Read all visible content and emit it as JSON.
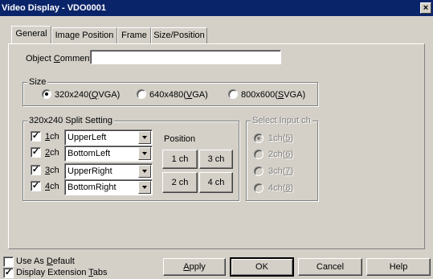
{
  "window": {
    "title": "Video Display - VDO0001",
    "close_glyph": "×"
  },
  "tabs": [
    {
      "label": "General",
      "active": true
    },
    {
      "label": "Image Position",
      "active": false
    },
    {
      "label": "Frame",
      "active": false
    },
    {
      "label": "Size/Position",
      "active": false
    }
  ],
  "object_comment": {
    "label_pre": "Object ",
    "label_key": "C",
    "label_post": "omment",
    "value": ""
  },
  "size": {
    "legend": "Size",
    "options": [
      {
        "pre": "320x240(",
        "key": "Q",
        "post": "VGA)",
        "checked": true
      },
      {
        "pre": "640x480(",
        "key": "V",
        "post": "GA)",
        "checked": false
      },
      {
        "pre": "800x600(",
        "key": "S",
        "post": "VGA)",
        "checked": false
      }
    ]
  },
  "split": {
    "legend": "320x240 Split Setting",
    "rows": [
      {
        "key": "1",
        "post": "ch",
        "checked": true,
        "value": "UpperLeft"
      },
      {
        "key": "2",
        "post": "ch",
        "checked": true,
        "value": "BottomLeft"
      },
      {
        "key": "3",
        "post": "ch",
        "checked": true,
        "value": "UpperRight"
      },
      {
        "key": "4",
        "post": "ch",
        "checked": true,
        "value": "BottomRight"
      }
    ],
    "position_label": "Position",
    "position_buttons": [
      "1 ch",
      "3 ch",
      "2 ch",
      "4 ch"
    ]
  },
  "select_input": {
    "legend": "Select Input ch",
    "options": [
      {
        "pre": "1ch(",
        "key": "5",
        "post": ")",
        "checked": true
      },
      {
        "pre": "2ch(",
        "key": "6",
        "post": ")",
        "checked": false
      },
      {
        "pre": "3ch(",
        "key": "7",
        "post": ")",
        "checked": false
      },
      {
        "pre": "4ch(",
        "key": "8",
        "post": ")",
        "checked": false
      }
    ]
  },
  "footer": {
    "use_default": {
      "pre": "Use As ",
      "key": "D",
      "post": "efault",
      "checked": false
    },
    "display_ext": {
      "pre": "Display Extension ",
      "key": "T",
      "post": "abs",
      "checked": true
    },
    "apply": {
      "key": "A",
      "post": "pply"
    },
    "ok": "OK",
    "cancel": "Cancel",
    "help": "Help"
  },
  "icons": {
    "check": "✓"
  }
}
